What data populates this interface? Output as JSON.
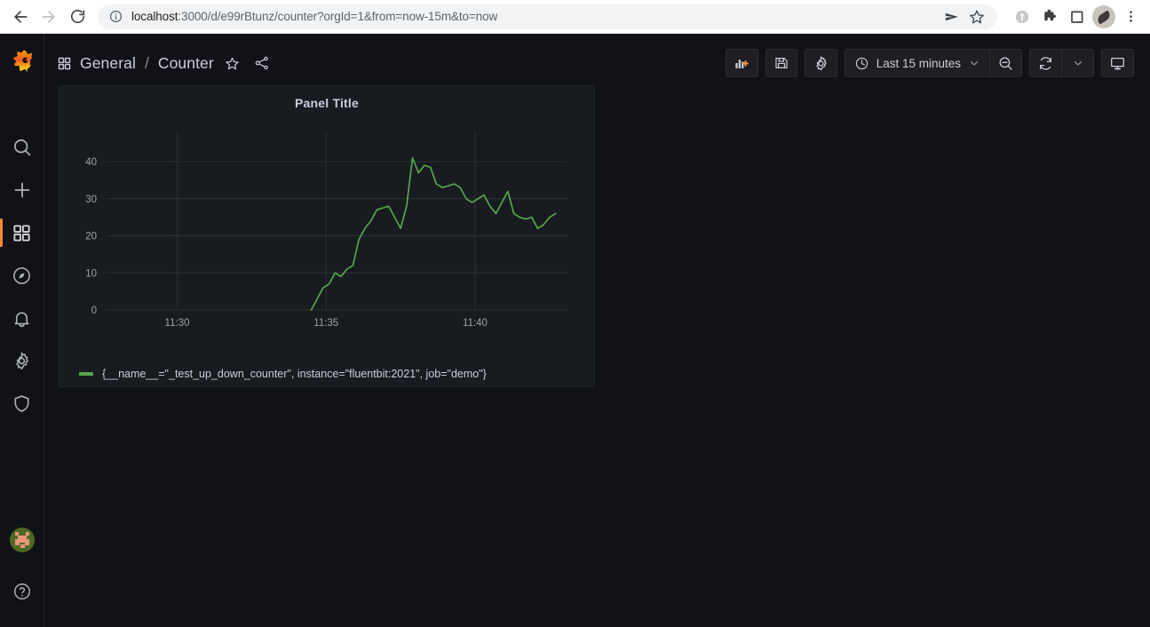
{
  "browser": {
    "url_display": "localhost:3000/d/e99rBtunz/counter?orgId=1&from=now-15m&to=now",
    "url_host": "localhost",
    "url_rest": ":3000/d/e99rBtunz/counter?orgId=1&from=now-15m&to=now",
    "back_icon": "arrow-left-icon",
    "forward_icon": "arrow-right-icon",
    "reload_icon": "reload-icon",
    "site_info_icon": "info-circle-icon",
    "share_icon": "send-icon",
    "bookmark_icon": "star-icon",
    "toolbar_icons": [
      "profile-circle-icon",
      "extensions-puzzle-icon",
      "side-panel-icon",
      "account-avatar-icon",
      "three-dot-menu-icon"
    ]
  },
  "sidebar": {
    "logo": "grafana-logo-icon",
    "items": [
      {
        "name": "search",
        "icon": "search-icon",
        "active": false
      },
      {
        "name": "create",
        "icon": "plus-icon",
        "active": false
      },
      {
        "name": "dashboards",
        "icon": "apps-grid-icon",
        "active": true
      },
      {
        "name": "explore",
        "icon": "compass-icon",
        "active": false
      },
      {
        "name": "alerting",
        "icon": "bell-icon",
        "active": false
      },
      {
        "name": "configuration",
        "icon": "gear-icon",
        "active": false
      },
      {
        "name": "server-admin",
        "icon": "shield-icon",
        "active": false
      }
    ],
    "user_avatar": "user-avatar-icon",
    "help": "help-circle-icon"
  },
  "topbar": {
    "dashboard_icon": "apps-grid-icon",
    "folder": "General",
    "separator": "/",
    "dashboard": "Counter",
    "star_icon": "star-outline-icon",
    "share_icon": "share-nodes-icon",
    "add_panel_icon": "add-panel-icon",
    "save_icon": "save-floppy-icon",
    "settings_icon": "gear-icon",
    "time_icon": "clock-icon",
    "time_range": "Last 15 minutes",
    "time_chevron": "chevron-down-icon",
    "zoom_out_icon": "zoom-out-icon",
    "refresh_icon": "refresh-icon",
    "refresh_chevron": "chevron-down-icon",
    "kiosk_icon": "monitor-icon"
  },
  "panel": {
    "title": "Panel Title",
    "legend": "{__name__=\"_test_up_down_counter\", instance=\"fluentbit:2021\", job=\"demo\"}"
  },
  "colors": {
    "accent_orange": "#ff8833",
    "series_green": "#56a64b",
    "panel_bg": "#181b1f",
    "app_bg": "#111217",
    "text_primary": "#ccccdc",
    "grid_line": "#2c3235"
  },
  "chart_data": {
    "type": "line",
    "title": "Panel Title",
    "xlabel": "",
    "ylabel": "",
    "grid": true,
    "legend_position": "bottom",
    "ylim": [
      0,
      46
    ],
    "yticks": [
      0,
      10,
      20,
      30,
      40
    ],
    "xticks": [
      "11:30",
      "11:35",
      "11:40"
    ],
    "xtick_minutes": [
      1530,
      1535,
      1540
    ],
    "xlim_minutes": [
      1527.6,
      1543.1
    ],
    "series": [
      {
        "name": "{__name__=\"_test_up_down_counter\", instance=\"fluentbit:2021\", job=\"demo\"}",
        "color": "#56a64b",
        "x": [
          1534.5,
          1534.7,
          1534.9,
          1535.1,
          1535.3,
          1535.5,
          1535.7,
          1535.9,
          1536.1,
          1536.3,
          1536.5,
          1536.7,
          1536.9,
          1537.1,
          1537.3,
          1537.5,
          1537.7,
          1537.9,
          1538.1,
          1538.3,
          1538.5,
          1538.7,
          1538.9,
          1539.1,
          1539.3,
          1539.5,
          1539.7,
          1539.9,
          1540.1,
          1540.3,
          1540.5,
          1540.7,
          1540.9,
          1541.1,
          1541.3,
          1541.5,
          1541.7,
          1541.9,
          1542.1,
          1542.3,
          1542.5,
          1542.7
        ],
        "y": [
          0,
          3,
          6,
          7,
          10,
          9,
          11,
          12,
          19,
          22,
          24,
          27,
          27.5,
          28,
          25,
          22,
          28,
          41,
          37,
          39,
          38.5,
          34,
          33,
          33.5,
          34,
          33,
          30,
          29,
          30,
          31,
          28,
          26,
          29,
          32,
          26,
          25,
          24.5,
          25,
          22,
          23,
          25,
          26
        ]
      }
    ]
  }
}
